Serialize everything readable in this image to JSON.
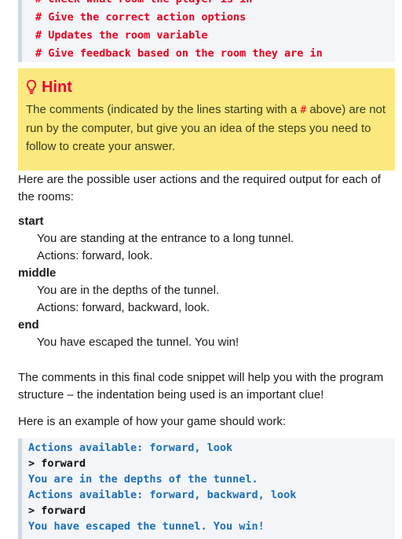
{
  "top_code": {
    "lines": [
      "# Check what room the player is in",
      "# Give the correct action options",
      "# Updates the room variable",
      "# Give feedback based on the room they are in"
    ]
  },
  "hint": {
    "icon": "lightbulb-icon",
    "title": "Hint",
    "body_before": "The comments (indicated by the lines starting with a ",
    "hash": "#",
    "body_after": " above) are not run by the computer, but give you an idea of the steps you need to follow to create your answer."
  },
  "intro": "Here are the possible user actions and the required output for each of the rooms:",
  "rooms": [
    {
      "name": "start",
      "lines": [
        "You are standing at the entrance to a long tunnel.",
        "Actions: forward, look."
      ]
    },
    {
      "name": "middle",
      "lines": [
        "You are in the depths of the tunnel.",
        "Actions: forward, backward, look."
      ]
    },
    {
      "name": "end",
      "lines": [
        "You have escaped the tunnel. You win!"
      ]
    }
  ],
  "structure_note": "The comments in this final code snippet will help you with the program structure – the indentation being used is an important clue!",
  "example_intro": "Here is an example of how your game should work:",
  "example_output": [
    {
      "text": "Actions available: forward, look",
      "kind": "output"
    },
    {
      "text": "> forward",
      "kind": "input"
    },
    {
      "text": "You are in the depths of the tunnel.",
      "kind": "output"
    },
    {
      "text": "Actions available: forward, backward, look",
      "kind": "output"
    },
    {
      "text": "> forward",
      "kind": "input"
    },
    {
      "text": "You have escaped the tunnel. You win!",
      "kind": "output"
    }
  ]
}
